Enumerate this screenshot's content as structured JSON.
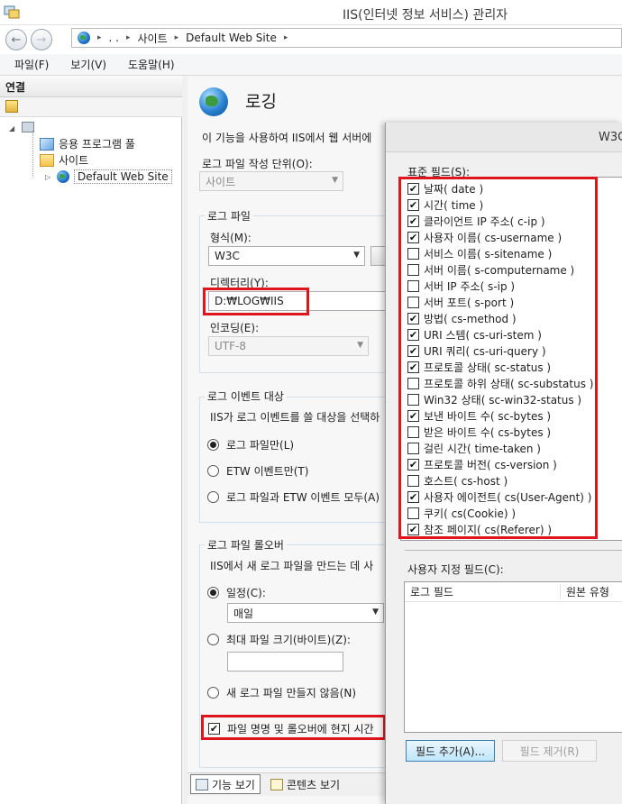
{
  "window": {
    "title": "IIS(인터넷 정보 서비스) 관리자",
    "icon": "iis-manager-icon"
  },
  "address": {
    "crumbs": [
      ". .",
      "사이트",
      "Default Web Site"
    ],
    "separator": "▸"
  },
  "menu": [
    "파일(F)",
    "보기(V)",
    "도움말(H)"
  ],
  "connections": {
    "header": "연결",
    "tree": [
      {
        "label": "응용 프로그램 풀",
        "icon": "app-pool-icon"
      },
      {
        "label": "사이트",
        "icon": "folder-icon"
      },
      {
        "label": "Default Web Site",
        "icon": "globe-icon"
      }
    ]
  },
  "logging": {
    "title": "로깅",
    "description": "이 기능을 사용하여 IIS에서 웹 서버에",
    "unit_label": "로그 파일 작성 단위(O):",
    "unit_value": "사이트",
    "logfile_group": "로그 파일",
    "format_label": "형식(M):",
    "format_value": "W3C",
    "directory_label": "디렉터리(Y):",
    "directory_value": "D:₩LOG₩IIS",
    "encoding_label": "인코딩(E):",
    "encoding_value": "UTF-8",
    "event_group": "로그 이벤트 대상",
    "event_desc": "IIS가 로그 이벤트를 쓸 대상을 선택하",
    "event_options": [
      "로그 파일만(L)",
      "ETW 이벤트만(T)",
      "로그 파일과 ETW 이벤트 모두(A)"
    ],
    "event_selected": 0,
    "rollover_group": "로그 파일 롤오버",
    "rollover_desc": "IIS에서 새 로그 파일을 만드는 데 사",
    "schedule_label": "일정(C):",
    "schedule_value": "매일",
    "maxsize_label": "최대 파일 크기(바이트)(Z):",
    "nonew_label": "새 로그 파일 만들지 않음(N)",
    "localtime_label": "파일 명명 및 롤오버에 현지 시간",
    "localtime_checked": true
  },
  "bottom_tabs": {
    "features": "기능 보기",
    "content": "콘텐츠 보기"
  },
  "dialog": {
    "title": "W3C",
    "standard_label": "표준 필드(S):",
    "fields": [
      {
        "label": "날짜( date )",
        "checked": true
      },
      {
        "label": "시간( time )",
        "checked": true
      },
      {
        "label": "클라이언트 IP 주소( c-ip )",
        "checked": true
      },
      {
        "label": "사용자 이름( cs-username )",
        "checked": true
      },
      {
        "label": "서비스 이름( s-sitename )",
        "checked": false
      },
      {
        "label": "서버 이름( s-computername )",
        "checked": false
      },
      {
        "label": "서버 IP 주소( s-ip )",
        "checked": false
      },
      {
        "label": "서버 포트( s-port )",
        "checked": false
      },
      {
        "label": "방법( cs-method )",
        "checked": true
      },
      {
        "label": "URI 스템( cs-uri-stem )",
        "checked": true
      },
      {
        "label": "URI 쿼리( cs-uri-query )",
        "checked": true
      },
      {
        "label": "프로토콜 상태( sc-status )",
        "checked": true
      },
      {
        "label": "프로토콜 하위 상태( sc-substatus )",
        "checked": false
      },
      {
        "label": "Win32 상태( sc-win32-status )",
        "checked": false
      },
      {
        "label": "보낸 바이트 수( sc-bytes )",
        "checked": true
      },
      {
        "label": "받은 바이트 수( cs-bytes )",
        "checked": false
      },
      {
        "label": "걸린 시간( time-taken )",
        "checked": false
      },
      {
        "label": "프로토콜 버전( cs-version )",
        "checked": true
      },
      {
        "label": "호스트( cs-host )",
        "checked": false
      },
      {
        "label": "사용자 에이전트( cs(User-Agent) )",
        "checked": true
      },
      {
        "label": "쿠키( cs(Cookie) )",
        "checked": false
      },
      {
        "label": "참조 페이지( cs(Referer) )",
        "checked": true
      }
    ],
    "custom_label": "사용자 지정 필드(C):",
    "custom_columns": [
      "로그 필드",
      "원본 유형"
    ],
    "add_button": "필드 추가(A)...",
    "remove_button": "필드 제거(R)"
  },
  "colors": {
    "highlight": "#e0141d",
    "accent": "#2a82d2"
  }
}
